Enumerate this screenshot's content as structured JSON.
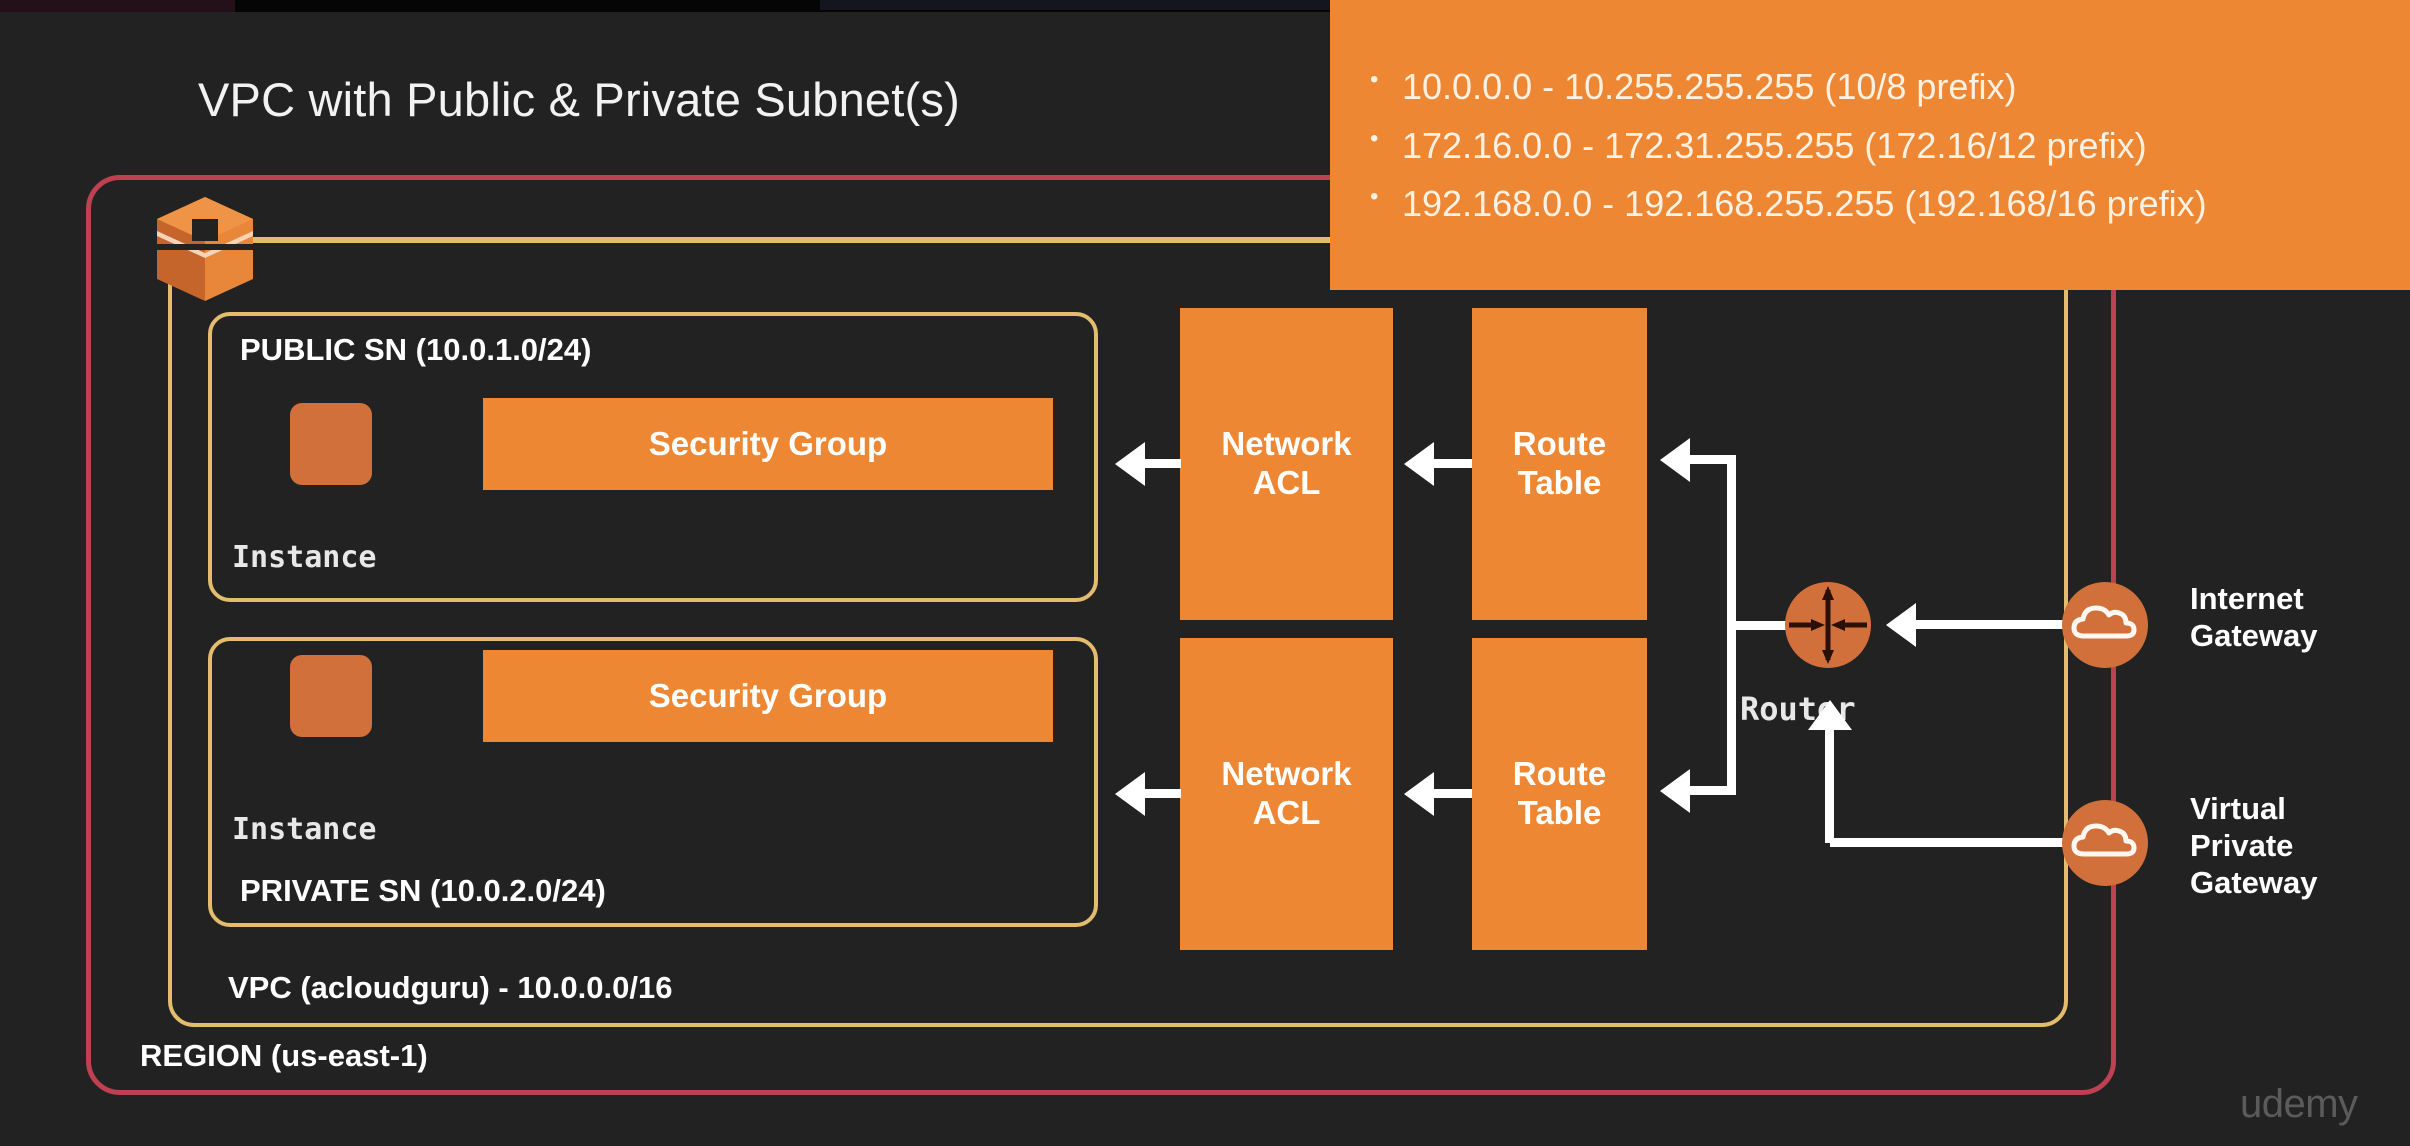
{
  "title": "VPC with Public & Private Subnet(s)",
  "colors": {
    "background": "#222222",
    "orange": "#ed8733",
    "orange_muted": "#d2703c",
    "gold_border": "#e3bd6d",
    "region_border": "#bf4051",
    "arrow_white": "#ffffff",
    "text_light": "#f2f2f2"
  },
  "region": {
    "label": "REGION (us-east-1)"
  },
  "vpc": {
    "label": "VPC (acloudguru) - 10.0.0.0/16",
    "logo_icon": "aws-cube-icon"
  },
  "subnets": [
    {
      "label": "PUBLIC SN (10.0.1.0/24)",
      "instance_label": "Instance",
      "instance_icon": "instance-square-icon",
      "security_group_label": "Security Group"
    },
    {
      "label": "PRIVATE SN (10.0.2.0/24)",
      "instance_label": "Instance",
      "instance_icon": "instance-square-icon",
      "security_group_label": "Security Group"
    }
  ],
  "network_components": {
    "nacl_label_line1": "Network",
    "nacl_label_line2": "ACL",
    "route_table_label_line1": "Route",
    "route_table_label_line2": "Table"
  },
  "router": {
    "label": "Router",
    "icon": "router-circle-icon"
  },
  "gateways": [
    {
      "label_line1": "Internet",
      "label_line2": "Gateway",
      "icon": "cloud-icon"
    },
    {
      "label_line1": "Virtual",
      "label_line2": "Private",
      "label_line3": "Gateway",
      "icon": "cloud-icon"
    }
  ],
  "ip_panel": {
    "items": [
      "10.0.0.0 - 10.255.255.255 (10/8 prefix)",
      "172.16.0.0 - 172.31.255.255 (172.16/12 prefix)",
      "192.168.0.0 - 192.168.255.255 (192.168/16 prefix)"
    ]
  },
  "watermark": "udemy"
}
